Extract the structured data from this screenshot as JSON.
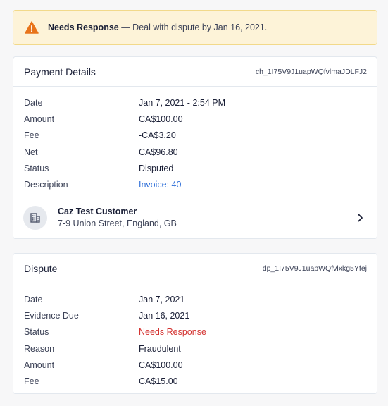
{
  "alert": {
    "status_label": "Needs Response",
    "message": " — Deal with dispute by Jan 16, 2021.",
    "icon": "warning-icon",
    "color": "#e8741b"
  },
  "payment": {
    "title": "Payment Details",
    "id": "ch_1I75V9J1uapWQfvlmaJDLFJ2",
    "rows": [
      {
        "label": "Date",
        "value": "Jan 7, 2021 - 2:54 PM"
      },
      {
        "label": "Amount",
        "value": "CA$100.00"
      },
      {
        "label": "Fee",
        "value": "-CA$3.20"
      },
      {
        "label": "Net",
        "value": "CA$96.80"
      },
      {
        "label": "Status",
        "value": "Disputed"
      },
      {
        "label": "Description",
        "value": "Invoice: 40"
      }
    ],
    "customer": {
      "name": "Caz Test Customer",
      "address": "7-9 Union Street, England, GB",
      "icon": "building-icon"
    }
  },
  "dispute": {
    "title": "Dispute",
    "id": "dp_1I75V9J1uapWQfvlxkg5Yfej",
    "rows": [
      {
        "label": "Date",
        "value": "Jan 7, 2021"
      },
      {
        "label": "Evidence Due",
        "value": "Jan 16, 2021"
      },
      {
        "label": "Status",
        "value": "Needs Response"
      },
      {
        "label": "Reason",
        "value": "Fraudulent"
      },
      {
        "label": "Amount",
        "value": "CA$100.00"
      },
      {
        "label": "Fee",
        "value": "CA$15.00"
      }
    ]
  },
  "colors": {
    "link": "#2f6fd8",
    "danger": "#d3312f",
    "alert_bg": "#fdf3d8"
  }
}
